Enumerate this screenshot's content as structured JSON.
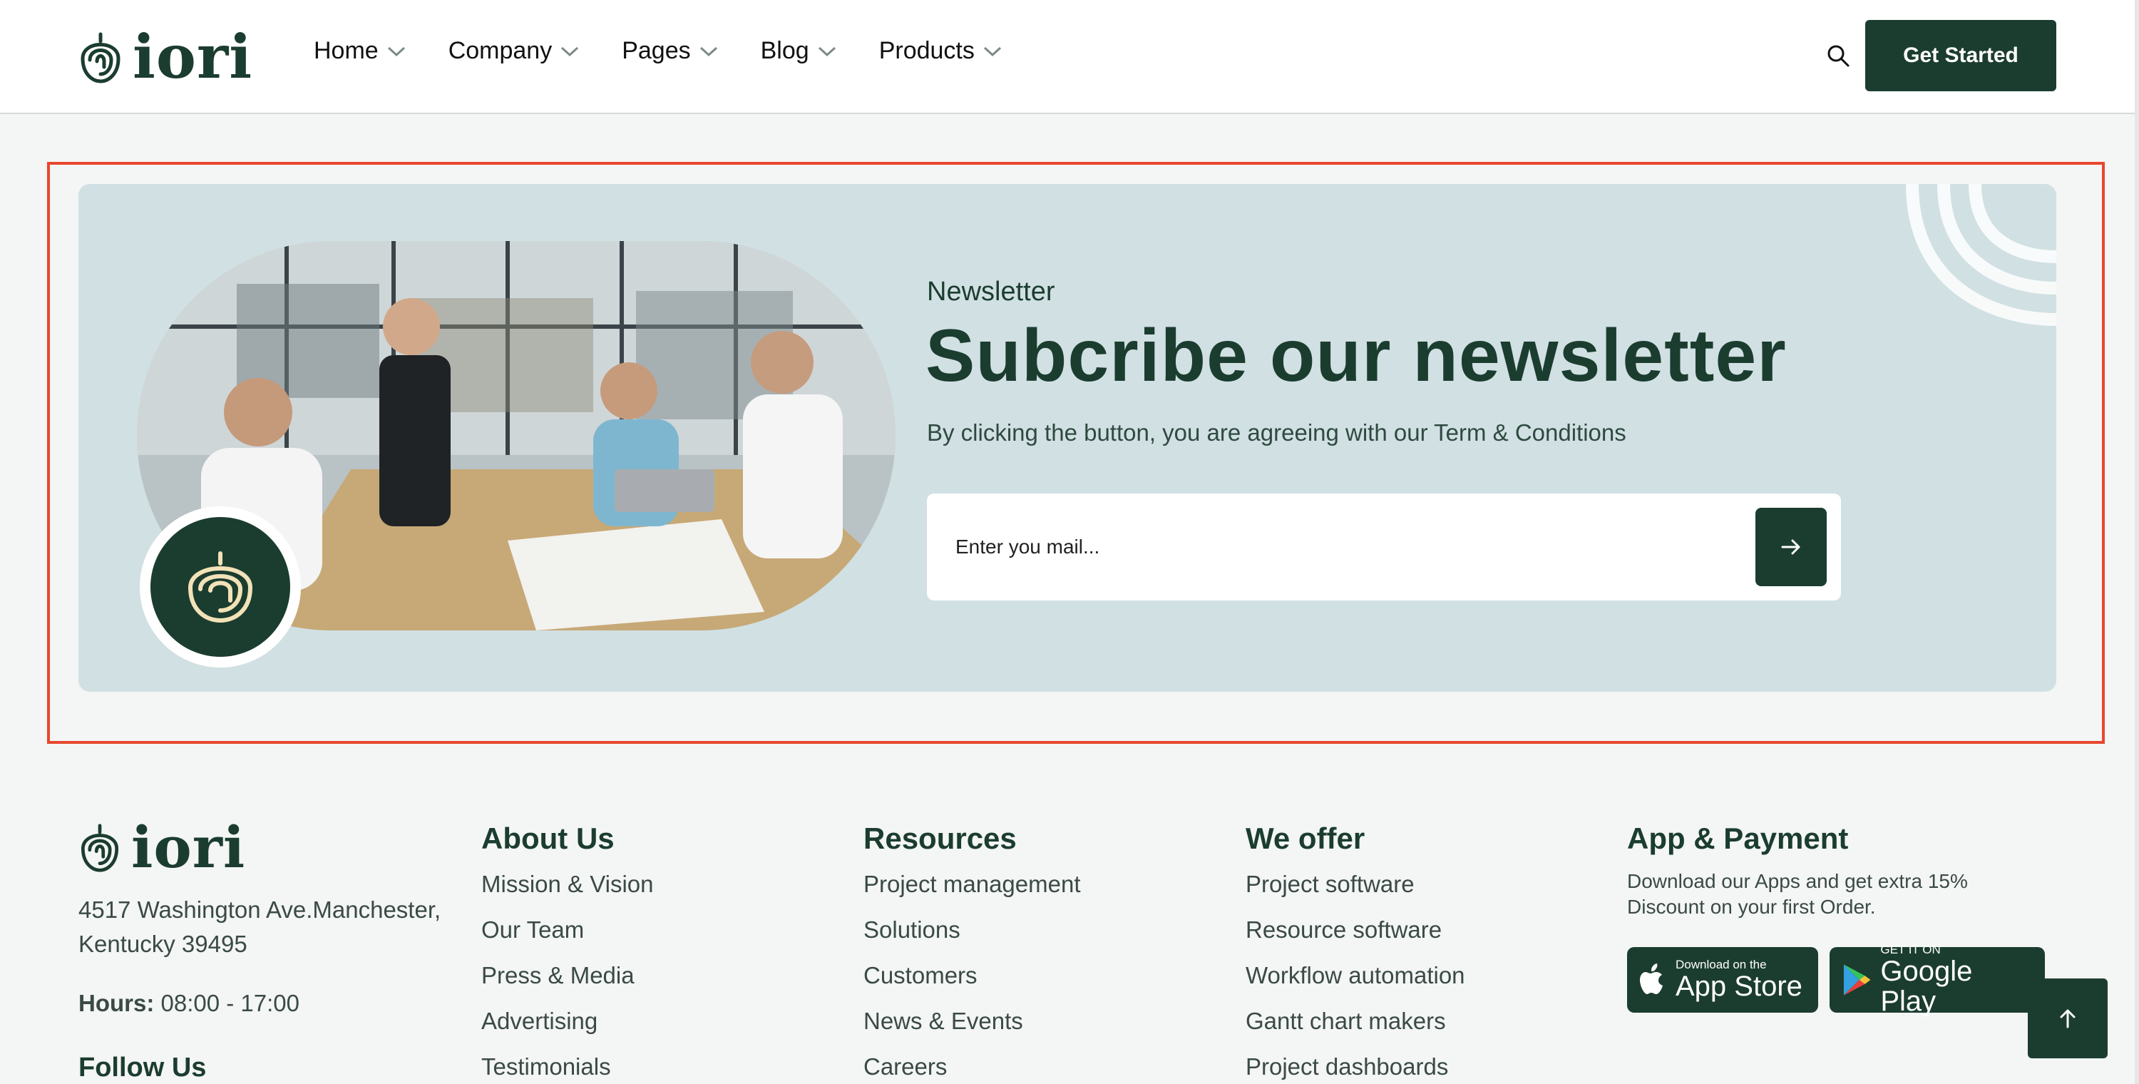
{
  "header": {
    "logo_text": "iori",
    "nav": [
      {
        "label": "Home"
      },
      {
        "label": "Company"
      },
      {
        "label": "Pages"
      },
      {
        "label": "Blog"
      },
      {
        "label": "Products"
      }
    ],
    "cta_label": "Get Started"
  },
  "newsletter": {
    "eyebrow": "Newsletter",
    "title": "Subcribe our newsletter",
    "description": "By clicking the button, you are agreeing with our Term & Conditions",
    "email_placeholder": "Enter you mail...",
    "submit_icon": "arrow-right-icon",
    "image_icon": "team-meeting-photo"
  },
  "footer": {
    "logo_text": "iori",
    "address": "4517 Washington Ave.Manchester, Kentucky 39495",
    "hours_label": "Hours:",
    "hours_value": "08:00 - 17:00",
    "follow_title": "Follow Us",
    "columns": [
      {
        "title": "About Us",
        "links": [
          "Mission & Vision",
          "Our Team",
          "Press & Media",
          "Advertising",
          "Testimonials"
        ]
      },
      {
        "title": "Resources",
        "links": [
          "Project management",
          "Solutions",
          "Customers",
          "News & Events",
          "Careers"
        ]
      },
      {
        "title": "We offer",
        "links": [
          "Project software",
          "Resource software",
          "Workflow automation",
          "Gantt chart makers",
          "Project dashboards"
        ]
      }
    ],
    "app": {
      "title": "App & Payment",
      "description": "Download our Apps and get extra 15% Discount on your first Order.",
      "app_store_small": "Download on the",
      "app_store_big": "App Store",
      "play_small": "GET IT ON",
      "play_big": "Google Play"
    }
  },
  "colors": {
    "brand_dark": "#1b3d2f",
    "newsletter_bg": "#d1e0e3",
    "highlight_frame": "#e8472d"
  }
}
